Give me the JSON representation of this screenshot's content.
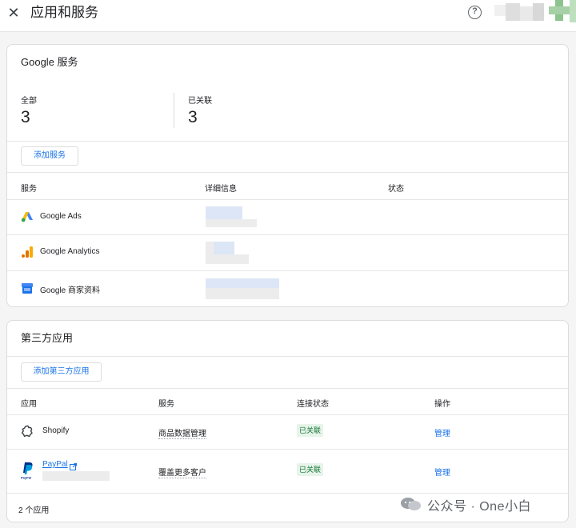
{
  "header": {
    "title": "应用和服务",
    "close_icon": "close-icon",
    "help_icon": "help-icon"
  },
  "google_services": {
    "title": "Google 服务",
    "stats": [
      {
        "label": "全部",
        "value": "3"
      },
      {
        "label": "已关联",
        "value": "3"
      }
    ],
    "add_button": "添加服务",
    "columns": [
      "服务",
      "详细信息",
      "状态"
    ],
    "rows": [
      {
        "name": "Google Ads",
        "icon": "google-ads-icon"
      },
      {
        "name": "Google Analytics",
        "icon": "google-analytics-icon"
      },
      {
        "name": "Google 商家资料",
        "icon": "google-business-profile-icon"
      }
    ]
  },
  "third_party": {
    "title": "第三方应用",
    "add_button": "添加第三方应用",
    "columns": [
      "应用",
      "服务",
      "连接状态",
      "操作"
    ],
    "rows": [
      {
        "app": "Shopify",
        "service": "商品数据管理",
        "status": "已关联",
        "action": "管理",
        "icon": "shopify-icon"
      },
      {
        "app": "PayPal",
        "service": "覆盖更多客户",
        "status": "已关联",
        "action": "管理",
        "icon": "paypal-icon"
      }
    ],
    "footer": "2 个应用"
  },
  "watermark": "公众号 · One小白",
  "colors": {
    "accent": "#1a73e8",
    "badge_bg": "#e6f4ea",
    "badge_text": "#137333"
  }
}
